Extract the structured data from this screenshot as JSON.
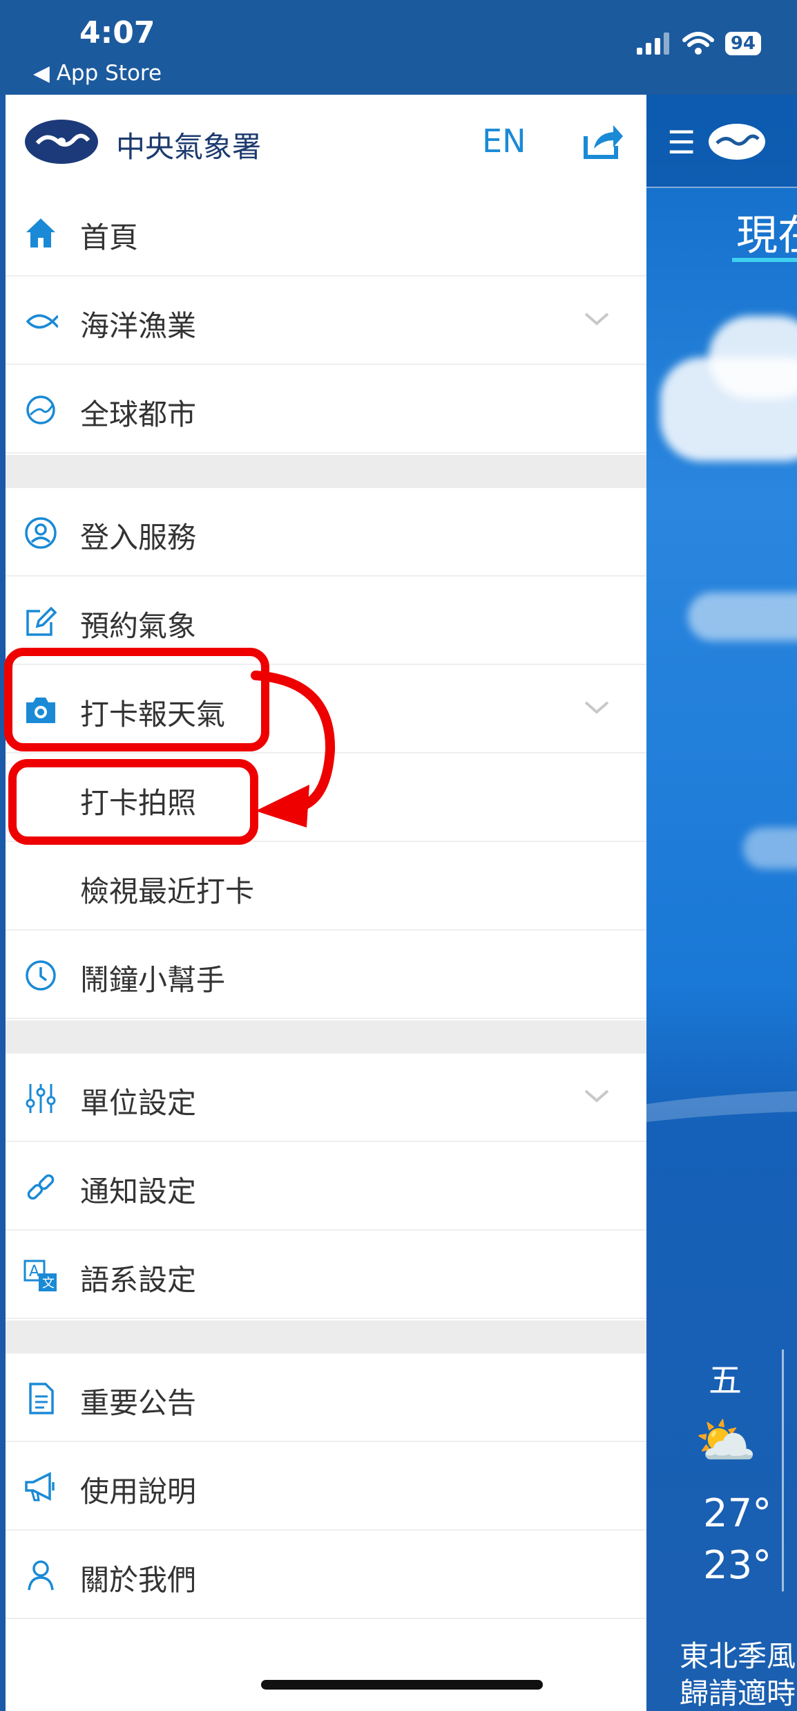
{
  "status_bar": {
    "time": "4:07",
    "back_label": "◀ App Store",
    "battery": "94"
  },
  "header": {
    "app_name": "中央氣象署",
    "lang_toggle": "EN"
  },
  "menu": {
    "home": "首頁",
    "ocean_fishery": "海洋漁業",
    "global_cities": "全球都市",
    "login_service": "登入服務",
    "scheduled_weather": "預約氣象",
    "checkin_weather": "打卡報天氣",
    "checkin_photo": "打卡拍照",
    "view_recent_checkins": "檢視最近打卡",
    "alarm_helper": "鬧鐘小幫手",
    "unit_settings": "單位設定",
    "notification_settings": "通知設定",
    "language_settings": "語系設定",
    "announcements": "重要公告",
    "instructions": "使用說明",
    "about_us": "關於我們"
  },
  "background": {
    "tab_partial": "現在",
    "day": "五",
    "high_temp": "27°",
    "low_temp": "23°",
    "note": "東北季風\n歸請適時"
  },
  "colors": {
    "accent": "#1a8ad6",
    "annotation": "#ee0000",
    "status_bar": "#1c5a9e"
  }
}
